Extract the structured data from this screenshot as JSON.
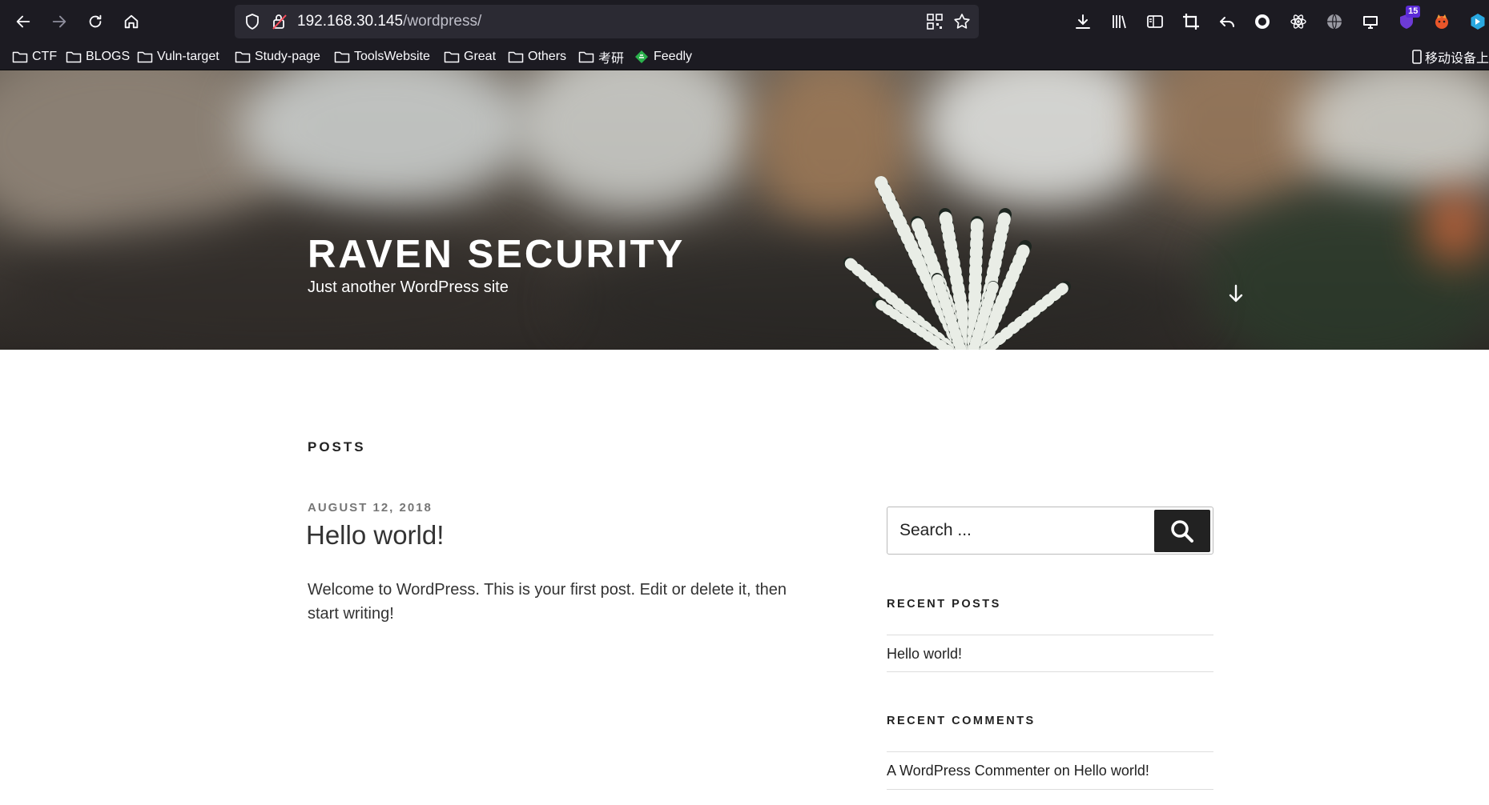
{
  "browser": {
    "url_host": "192.168.30.145",
    "url_path": "/wordpress/",
    "extension_badge": "15",
    "bookmarks": [
      {
        "label": "CTF"
      },
      {
        "label": "BLOGS"
      },
      {
        "label": "Vuln-target"
      },
      {
        "label": "Study-page"
      },
      {
        "label": "ToolsWebsite"
      },
      {
        "label": "Great"
      },
      {
        "label": "Others"
      },
      {
        "label": "考研"
      },
      {
        "label": "Feedly"
      }
    ],
    "mobile_bookmarks_label": "移动设备上"
  },
  "site": {
    "title": "RAVEN SECURITY",
    "description": "Just another WordPress site"
  },
  "main": {
    "posts_heading": "POSTS",
    "post": {
      "date": "AUGUST 12, 2018",
      "title": "Hello world!",
      "excerpt": "Welcome to WordPress. This is your first post. Edit or delete it, then start writing!"
    }
  },
  "sidebar": {
    "search_placeholder": "Search ...",
    "recent_posts_title": "RECENT POSTS",
    "recent_posts": [
      "Hello world!"
    ],
    "recent_comments_title": "RECENT COMMENTS",
    "recent_comment": {
      "author": "A WordPress Commenter",
      "connector": "on",
      "post": "Hello world!"
    }
  },
  "colors": {
    "chrome_bg": "#1c1b22",
    "urlbar_bg": "#2b2a33",
    "text_dark": "#222222",
    "meta_grey": "#767676"
  }
}
